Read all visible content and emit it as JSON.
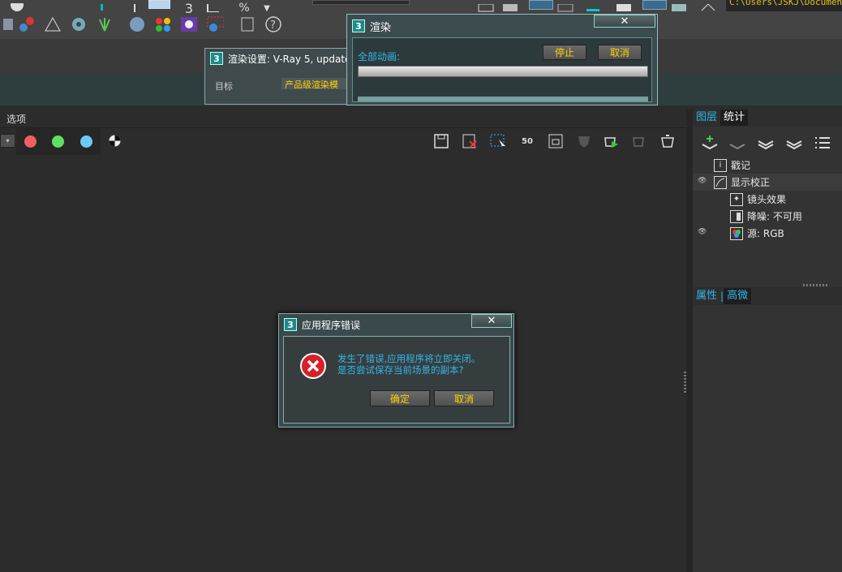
{
  "toolbar": {
    "path_text": "C:\\Users\\JSKJ\\Documen"
  },
  "render_settings_window": {
    "title": "渲染设置: V-Ray 5, update",
    "partial_label": "目标",
    "partial_value": "产品级渲染模"
  },
  "render_window": {
    "title": "渲染",
    "progress_label": "全部动画:",
    "stop_label": "停止",
    "cancel_label": "取消",
    "progress_fraction": 0
  },
  "vfb": {
    "options_label": "选项",
    "lens_value": "50"
  },
  "right_panel": {
    "tab_layers": "图层",
    "tab_stats": "统计",
    "layers": [
      {
        "label": "戳记",
        "eye": false,
        "indent": 0
      },
      {
        "label": "显示校正",
        "eye": true,
        "indent": 0
      },
      {
        "label": "镜头效果",
        "eye": false,
        "indent": 1
      },
      {
        "label": "降噪: 不可用",
        "eye": false,
        "indent": 1
      },
      {
        "label": "源: RGB",
        "eye": true,
        "indent": 1
      }
    ],
    "props_tab": "属性",
    "props_sep": "|",
    "advanced_tab": "高微"
  },
  "error_dialog": {
    "title": "应用程序错误",
    "message_line1": "发生了错误,应用程序将立即关闭。",
    "message_line2": "是否尝试保存当前场景的副本?",
    "ok_label": "确定",
    "cancel_label": "取消"
  },
  "colors": {
    "accent_yellow": "#ffd200",
    "message_cyan": "#32b7e8",
    "error_red": "#d8202a",
    "red_channel": "#f06060",
    "green_channel": "#60e060",
    "blue_channel": "#6ccaf8"
  }
}
